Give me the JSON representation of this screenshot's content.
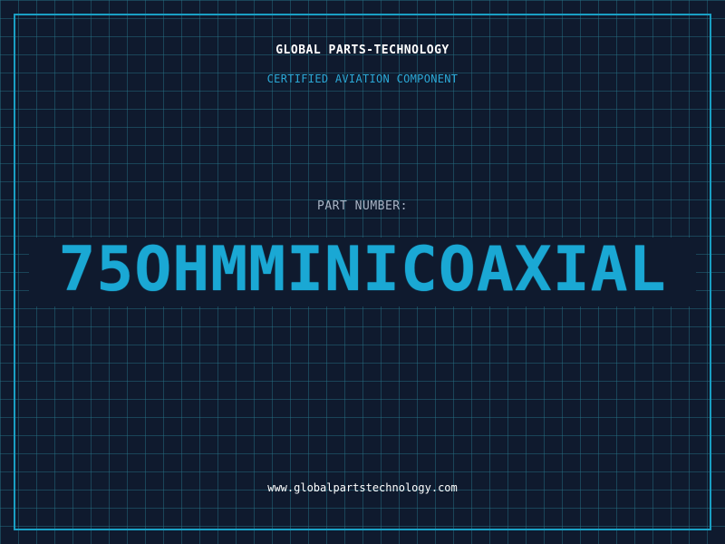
{
  "header": {
    "company": "GLOBAL PARTS-TECHNOLOGY",
    "tagline": "CERTIFIED AVIATION COMPONENT"
  },
  "part": {
    "label": "PART NUMBER:",
    "number": "75OHMMINICOAXIAL"
  },
  "footer": {
    "url": "www.globalpartstechnology.com"
  },
  "colors": {
    "background": "#0f1a2e",
    "grid": "#28788c",
    "accent": "#1aa8d4",
    "frame": "#1a9fc4",
    "label": "#a8b3c4",
    "text": "#ffffff"
  }
}
